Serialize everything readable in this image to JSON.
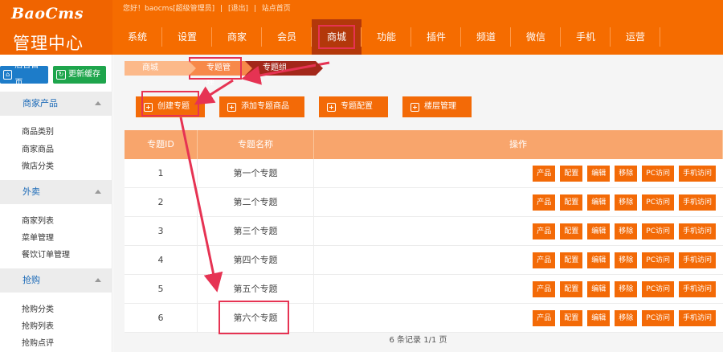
{
  "header": {
    "logo": "BaoCms",
    "logo_sub": "管理中心",
    "topbar": {
      "greeting": "您好！baocms[超级管理员]",
      "sep": "|",
      "logout": "[退出]",
      "site_home": "站点首页"
    },
    "nav": [
      "系统",
      "设置",
      "商家",
      "会员",
      "商城",
      "功能",
      "插件",
      "频道",
      "微信",
      "手机",
      "运营"
    ],
    "active_nav": "商城"
  },
  "sidebar": {
    "home_btn": "后台首页",
    "cache_btn": "更新缓存",
    "groups": [
      {
        "title": "商家产品",
        "items": [
          "商品类别",
          "商家商品",
          "微店分类"
        ]
      },
      {
        "title": "外卖",
        "items": [
          "商家列表",
          "菜单管理",
          "餐饮订单管理"
        ]
      },
      {
        "title": "抢购",
        "items": [
          "抢购分类",
          "抢购列表",
          "抢购点评"
        ]
      }
    ]
  },
  "breadcrumb": [
    "商城",
    "专题管理",
    "专题组"
  ],
  "actions": [
    "创建专题",
    "添加专题商品",
    "专题配置",
    "楼层管理"
  ],
  "table": {
    "headers": [
      "专题ID",
      "专题名称",
      "操作"
    ],
    "rows": [
      {
        "id": "1",
        "name": "第一个专题"
      },
      {
        "id": "2",
        "name": "第二个专题"
      },
      {
        "id": "3",
        "name": "第三个专题"
      },
      {
        "id": "4",
        "name": "第四个专题"
      },
      {
        "id": "5",
        "name": "第五个专题"
      },
      {
        "id": "6",
        "name": "第六个专题"
      }
    ],
    "ops": [
      "产品",
      "配置",
      "编辑",
      "移除",
      "PC访问",
      "手机访问"
    ]
  },
  "pager": "6 条记录 1/1 页",
  "colors": {
    "brand": "#f56c00",
    "button": "#f36a07",
    "annotation": "#e63353"
  }
}
